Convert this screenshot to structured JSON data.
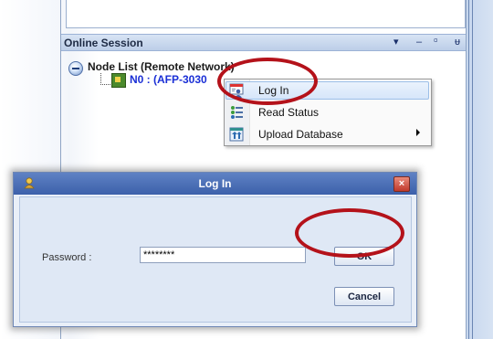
{
  "session_panel": {
    "title": "Online Session",
    "controls": {
      "dropdown": "▾",
      "minimize": "‒",
      "maximize": "▫",
      "pin": "ᵾ"
    }
  },
  "tree": {
    "root_label": "Node List (Remote Network)",
    "node_label": "N0 : (AFP-3030"
  },
  "context_menu": {
    "items": [
      {
        "label": "Log In",
        "icon": "login-user-icon",
        "selected": true
      },
      {
        "label": "Read Status",
        "icon": "read-status-icon"
      },
      {
        "label": "Upload Database",
        "icon": "upload-database-icon",
        "has_submenu": true
      }
    ]
  },
  "dialog": {
    "title": "Log In",
    "password_label": "Password :",
    "password_value": "********",
    "ok_label": "OK",
    "cancel_label": "Cancel",
    "close_glyph": "×"
  },
  "colors": {
    "highlight_ellipse": "#b4121a",
    "titlebar": "#3c60aa",
    "node_text": "#1a2fd6"
  }
}
